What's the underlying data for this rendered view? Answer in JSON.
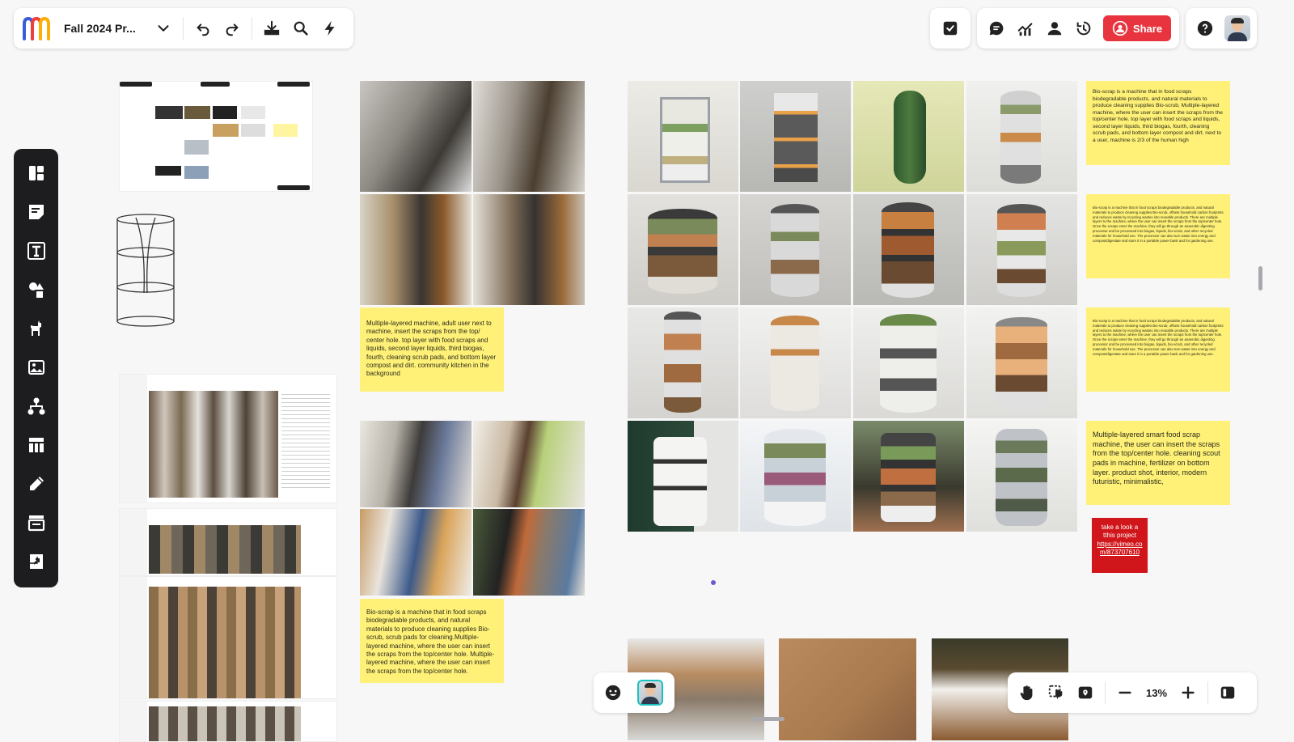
{
  "header": {
    "board_title": "Fall 2024 Pr...",
    "share_label": "Share"
  },
  "colors": {
    "share_red": "#e8343e",
    "sticky_yellow": "#fff178",
    "sticky_red": "#d0161b",
    "toolbar_dark": "#1d1d1f"
  },
  "icons": {
    "top_left": [
      "undo-icon",
      "redo-icon",
      "export-icon",
      "search-icon",
      "lightning-icon"
    ],
    "top_right": [
      "checkbox-icon",
      "comment-icon",
      "activity-icon",
      "user-icon",
      "history-icon",
      "help-icon"
    ],
    "left_bar": [
      "templates-icon",
      "sticky-note-icon",
      "text-icon",
      "shapes-icon",
      "llama-icon",
      "image-icon",
      "diagram-icon",
      "table-icon",
      "pen-icon",
      "frame-icon",
      "embed-icon"
    ],
    "bottom_right": [
      "hand-icon",
      "select-icon",
      "map-icon"
    ]
  },
  "stickies": {
    "s1": "Multiple-layered machine, adult user next to machine, insert the scraps from the top/ center hole. top layer with food scraps and liquids, second layer liquids, third biogas, fourth, cleaning scrub pads, and bottom layer compost and dirt. community kitchen in the background",
    "s2": "Bio-scrap is a machine that in food scraps biodegradable products, and natural materials to produce cleaning supplies Bio-scrub, scrub pads for cleaning.Multiple-layered machine, where the user can insert the scraps from the top/center hole. Multiple-layered machine, where the user can insert the scraps from the top/center hole.",
    "s3": "Bio-scrap is a machine that in food scraps biodegradable products, and natural materials to produce cleaning supplies Bio-scrub, Multiple-layered machine, where the user can insert the scraps from the top/center hole. top layer with food scraps and liquids, second layer liquids, third biogas, fourth, cleaning scrub pads, and bottom layer compost and dirt. next to a user, machine is 2/3 of the human high",
    "s4": "Bio-scrap is a machine that in food scraps biodegradable products, and natural materials to produce cleaning supplies Bio-scrub, offsets household carbon footprints and reduces waste by recycling wastes into reusable products. There are multiple layers to the machine, where the user can insert the scraps from the top/center hole. Once the scraps enter the machine, they will go through an anaerobic digesting processor and be processed into biogas, liquids, bio-scrub, and other recycled materials for household use. The processor can also turn waste into energy and compost/digestate and store it in a portable power bank and for gardening use.",
    "s5": "Bio-scrap is a machine that in food scraps biodegradable products, and natural materials to produce cleaning supplies Bio-scrub, offsets household carbon footprints and reduces waste by recycling wastes into reusable products. There are multiple layers to the machine, where the user can insert the scraps from the top/center hole. Once the scraps enter the machine, they will go through an anaerobic digesting processor and be processed into biogas, liquids, bio-scrub, and other recycled materials for household use. The processor can also turn waste into energy and compost/digestate and store it in a portable power bank and for gardening use.",
    "s6": "Multiple-layered smart food scrap machine, the user can insert the scraps from the top/center hole. cleaning scout pads in machine, fertilizer on bottom layer. product shot, interior, modern futuristic, minimalistic,",
    "red_line1": "take a look a tthis project",
    "red_link": "https://vimeo.com/873707610"
  },
  "zoom": {
    "level": "13%"
  }
}
